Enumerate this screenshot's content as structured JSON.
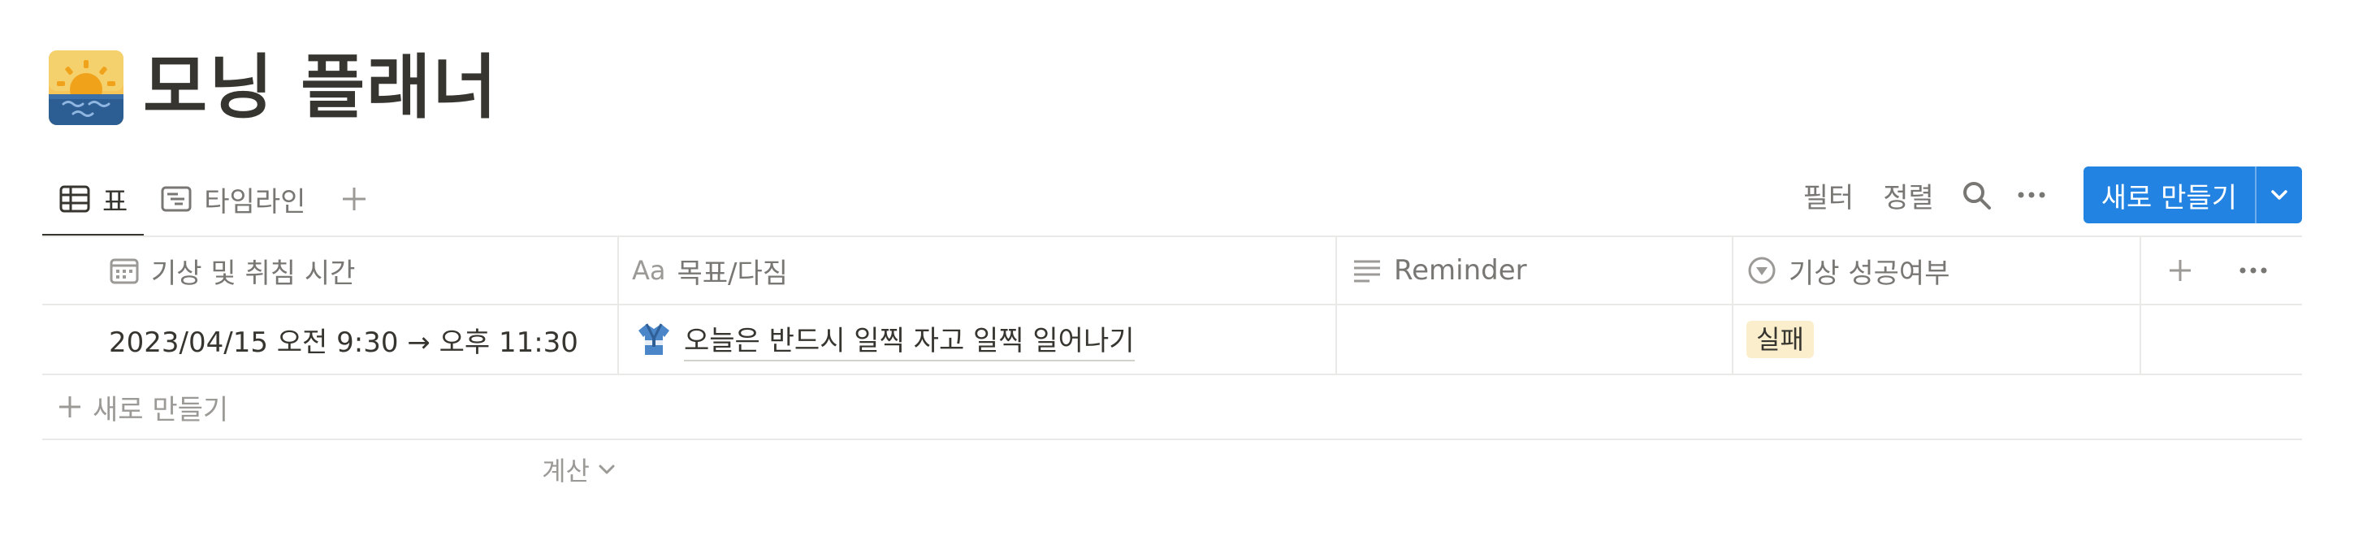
{
  "page": {
    "title": "모닝 플래너",
    "icon": "sunrise-over-water-icon"
  },
  "views": {
    "tabs": [
      {
        "label": "표",
        "icon": "table-icon",
        "active": true
      },
      {
        "label": "타임라인",
        "icon": "timeline-icon",
        "active": false
      }
    ],
    "add_icon": "plus-icon"
  },
  "toolbar": {
    "filter_label": "필터",
    "sort_label": "정렬",
    "search_icon": "search-icon",
    "more_icon": "more-icon",
    "new_label": "새로 만들기",
    "new_dropdown_icon": "chevron-down-icon"
  },
  "table": {
    "columns": [
      {
        "label": "기상 및 취침 시간",
        "icon": "calendar-icon"
      },
      {
        "label": "목표/다짐",
        "icon": "title-aa-icon",
        "icon_text": "Aa"
      },
      {
        "label": "Reminder",
        "icon": "text-lines-icon"
      },
      {
        "label": "기상 성공여부",
        "icon": "select-icon"
      }
    ],
    "rows": [
      {
        "date": "2023/04/15 오전 9:30 → 오후 11:30",
        "goal_icon": "judo-uniform-icon",
        "goal": "오늘은 반드시 일찍 자고 일찍 일어나기",
        "reminder": "",
        "status": "실패"
      }
    ],
    "new_row_label": "새로 만들기",
    "calc_label": "계산"
  },
  "colors": {
    "accent": "#2383e2",
    "text": "#37352f",
    "muted": "#787774",
    "border": "#e9e9e7",
    "tag_fail_bg": "#fbeecd"
  }
}
